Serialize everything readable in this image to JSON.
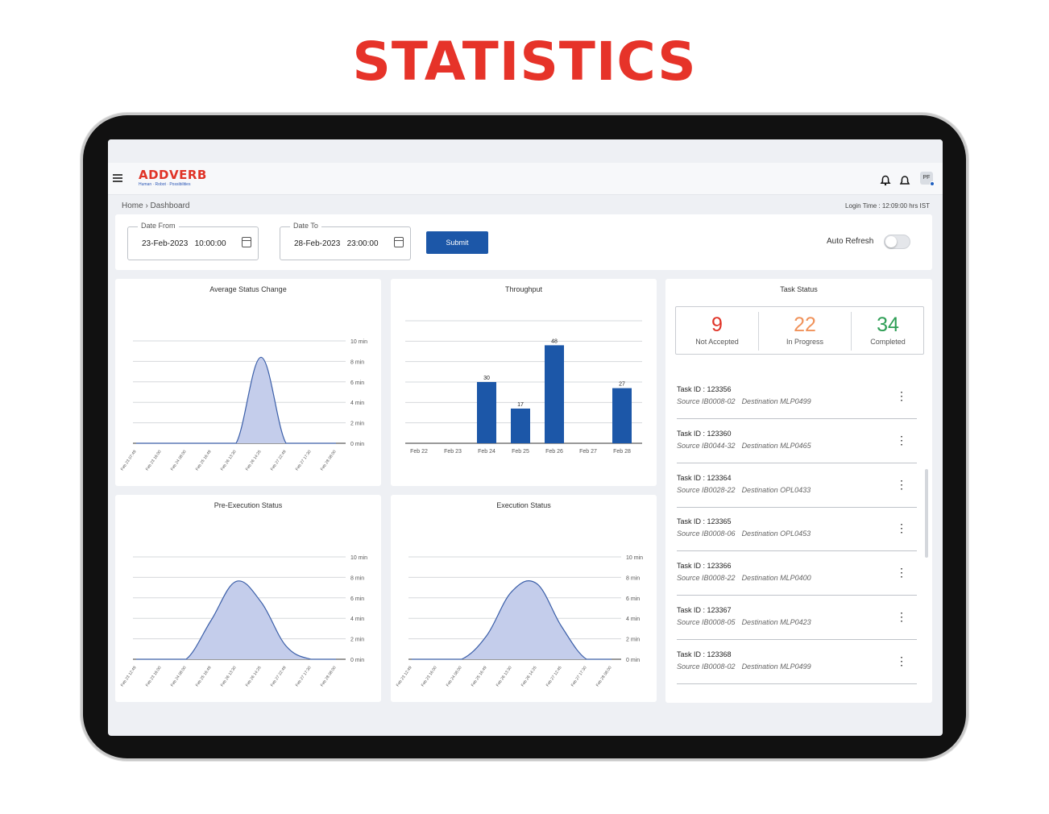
{
  "headline": "STATISTICS",
  "app": {
    "logo": "ADDVERB",
    "tagline": "Human · Robot · Possibilities",
    "avatar_initials": "PF",
    "icons": [
      "menu-icon",
      "bell-icon",
      "notification-icon",
      "avatar"
    ]
  },
  "breadcrumb": "Home › Dashboard",
  "login_time": "Login Time : 12:09:00 hrs IST",
  "filters": {
    "date_from_label": "Date From",
    "date_from_value": "23-Feb-2023   10:00:00",
    "date_to_label": "Date To",
    "date_to_value": "28-Feb-2023   23:00:00",
    "submit_label": "Submit",
    "auto_refresh_label": "Auto Refresh",
    "auto_refresh_on": false
  },
  "colors": {
    "brand_red": "#e63329",
    "accent_blue": "#1c57a8",
    "not_accepted": "#e03327",
    "in_progress": "#f0925a",
    "completed": "#2e9e55"
  },
  "chart_data": [
    {
      "type": "area",
      "title": "Average Status Change",
      "y_ticks": [
        "10 min",
        "8 min",
        "6 min",
        "4 min",
        "2 min",
        "0 min"
      ],
      "ylim": [
        0,
        10
      ],
      "x_ticks": [
        "Feb 23 07:49",
        "Feb 23 16:00",
        "Feb 24 08:00",
        "Feb 25 16:49",
        "Feb 26 13:30",
        "Feb 26 14:25",
        "Feb 27 22:49",
        "Feb 27 17:30",
        "Feb 28 08:00"
      ],
      "x": [
        0,
        1,
        2,
        3,
        4,
        5,
        6,
        7,
        8
      ],
      "values": [
        0,
        0,
        0,
        0,
        0,
        8.4,
        0,
        0,
        0
      ]
    },
    {
      "type": "bar",
      "title": "Throughput",
      "categories": [
        "Feb 22",
        "Feb 23",
        "Feb 24",
        "Feb 25",
        "Feb 26",
        "Feb 27",
        "Feb 28"
      ],
      "values": [
        0,
        0,
        30,
        17,
        48,
        0,
        27
      ],
      "data_labels": [
        "",
        "",
        "30",
        "17",
        "48",
        "",
        "27"
      ],
      "ylim": [
        0,
        60
      ],
      "grid": true
    },
    {
      "type": "area",
      "title": "Pre-Execution Status",
      "y_ticks": [
        "10 min",
        "8 min",
        "6 min",
        "4 min",
        "2 min",
        "0 min"
      ],
      "ylim": [
        0,
        10
      ],
      "x_ticks": [
        "Feb 23 12:49",
        "Feb 23 16:00",
        "Feb 24 08:00",
        "Feb 25 16:49",
        "Feb 26 13:30",
        "Feb 26 14:25",
        "Feb 27 22:49",
        "Feb 27 17:30",
        "Feb 28 08:00"
      ],
      "x": [
        0,
        1,
        2,
        3,
        4,
        5,
        6,
        7,
        8
      ],
      "values": [
        0,
        0,
        0,
        3.8,
        7.6,
        5.6,
        1.3,
        0,
        0
      ]
    },
    {
      "type": "area",
      "title": "Execution Status",
      "y_ticks": [
        "10 min",
        "8 min",
        "6 min",
        "4 min",
        "2 min",
        "0 min"
      ],
      "ylim": [
        0,
        10
      ],
      "x_ticks": [
        "Feb 23 12:49",
        "Feb 23 16:00",
        "Feb 24 08:00",
        "Feb 25 16:49",
        "Feb 26 13:30",
        "Feb 26 14:25",
        "Feb 27 12:45",
        "Feb 27 17:30",
        "Feb 28 08:00"
      ],
      "x": [
        0,
        1,
        2,
        3,
        4,
        5,
        6,
        7,
        8
      ],
      "values": [
        0,
        0,
        0,
        2.3,
        6.6,
        7.4,
        3.2,
        0,
        0
      ]
    }
  ],
  "task_status": {
    "title": "Task Status",
    "counts": [
      {
        "value": "9",
        "label": "Not Accepted"
      },
      {
        "value": "22",
        "label": "In Progress"
      },
      {
        "value": "34",
        "label": "Completed"
      }
    ],
    "tasks": [
      {
        "id": "Task ID : 123356",
        "source": "Source IB0008-02",
        "destination": "Destination MLP0499"
      },
      {
        "id": "Task ID : 123360",
        "source": "Source IB0044-32",
        "destination": "Destination MLP0465"
      },
      {
        "id": "Task ID : 123364",
        "source": "Source IB0028-22",
        "destination": "Destination OPL0433"
      },
      {
        "id": "Task ID : 123365",
        "source": "Source IB0008-06",
        "destination": "Destination OPL0453"
      },
      {
        "id": "Task ID : 123366",
        "source": "Source IB0008-22",
        "destination": "Destination MLP0400"
      },
      {
        "id": "Task ID : 123367",
        "source": "Source IB0008-05",
        "destination": "Destination MLP0423"
      },
      {
        "id": "Task ID : 123368",
        "source": "Source IB0008-02",
        "destination": "Destination MLP0499"
      }
    ]
  }
}
